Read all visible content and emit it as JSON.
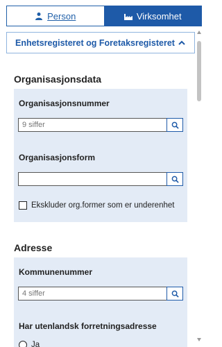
{
  "tabs": [
    {
      "label": "Person",
      "icon": "person-icon",
      "active": false
    },
    {
      "label": "Virksomhet",
      "icon": "factory-icon",
      "active": true
    }
  ],
  "accordion": {
    "title": "Enhetsregisteret og Foretaksregisteret",
    "icon": "chevron-up-icon"
  },
  "sections": {
    "organisasjonsdata": {
      "title": "Organisasjonsdata",
      "orgnr": {
        "label": "Organisasjonsnummer",
        "placeholder": "9 siffer"
      },
      "orgform": {
        "label": "Organisasjonsform",
        "placeholder": ""
      },
      "exclude": {
        "label": "Ekskluder org.former som er underenhet",
        "checked": false
      }
    },
    "adresse": {
      "title": "Adresse",
      "kommunenr": {
        "label": "Kommunenummer",
        "placeholder": "4 siffer"
      },
      "utenlandsk": {
        "label": "Har utenlandsk forretningsadresse",
        "option_ja": "Ja"
      }
    }
  },
  "colors": {
    "accent": "#1e5aa8",
    "panel_bg": "#e3ebf6",
    "border": "#8fb4de"
  }
}
